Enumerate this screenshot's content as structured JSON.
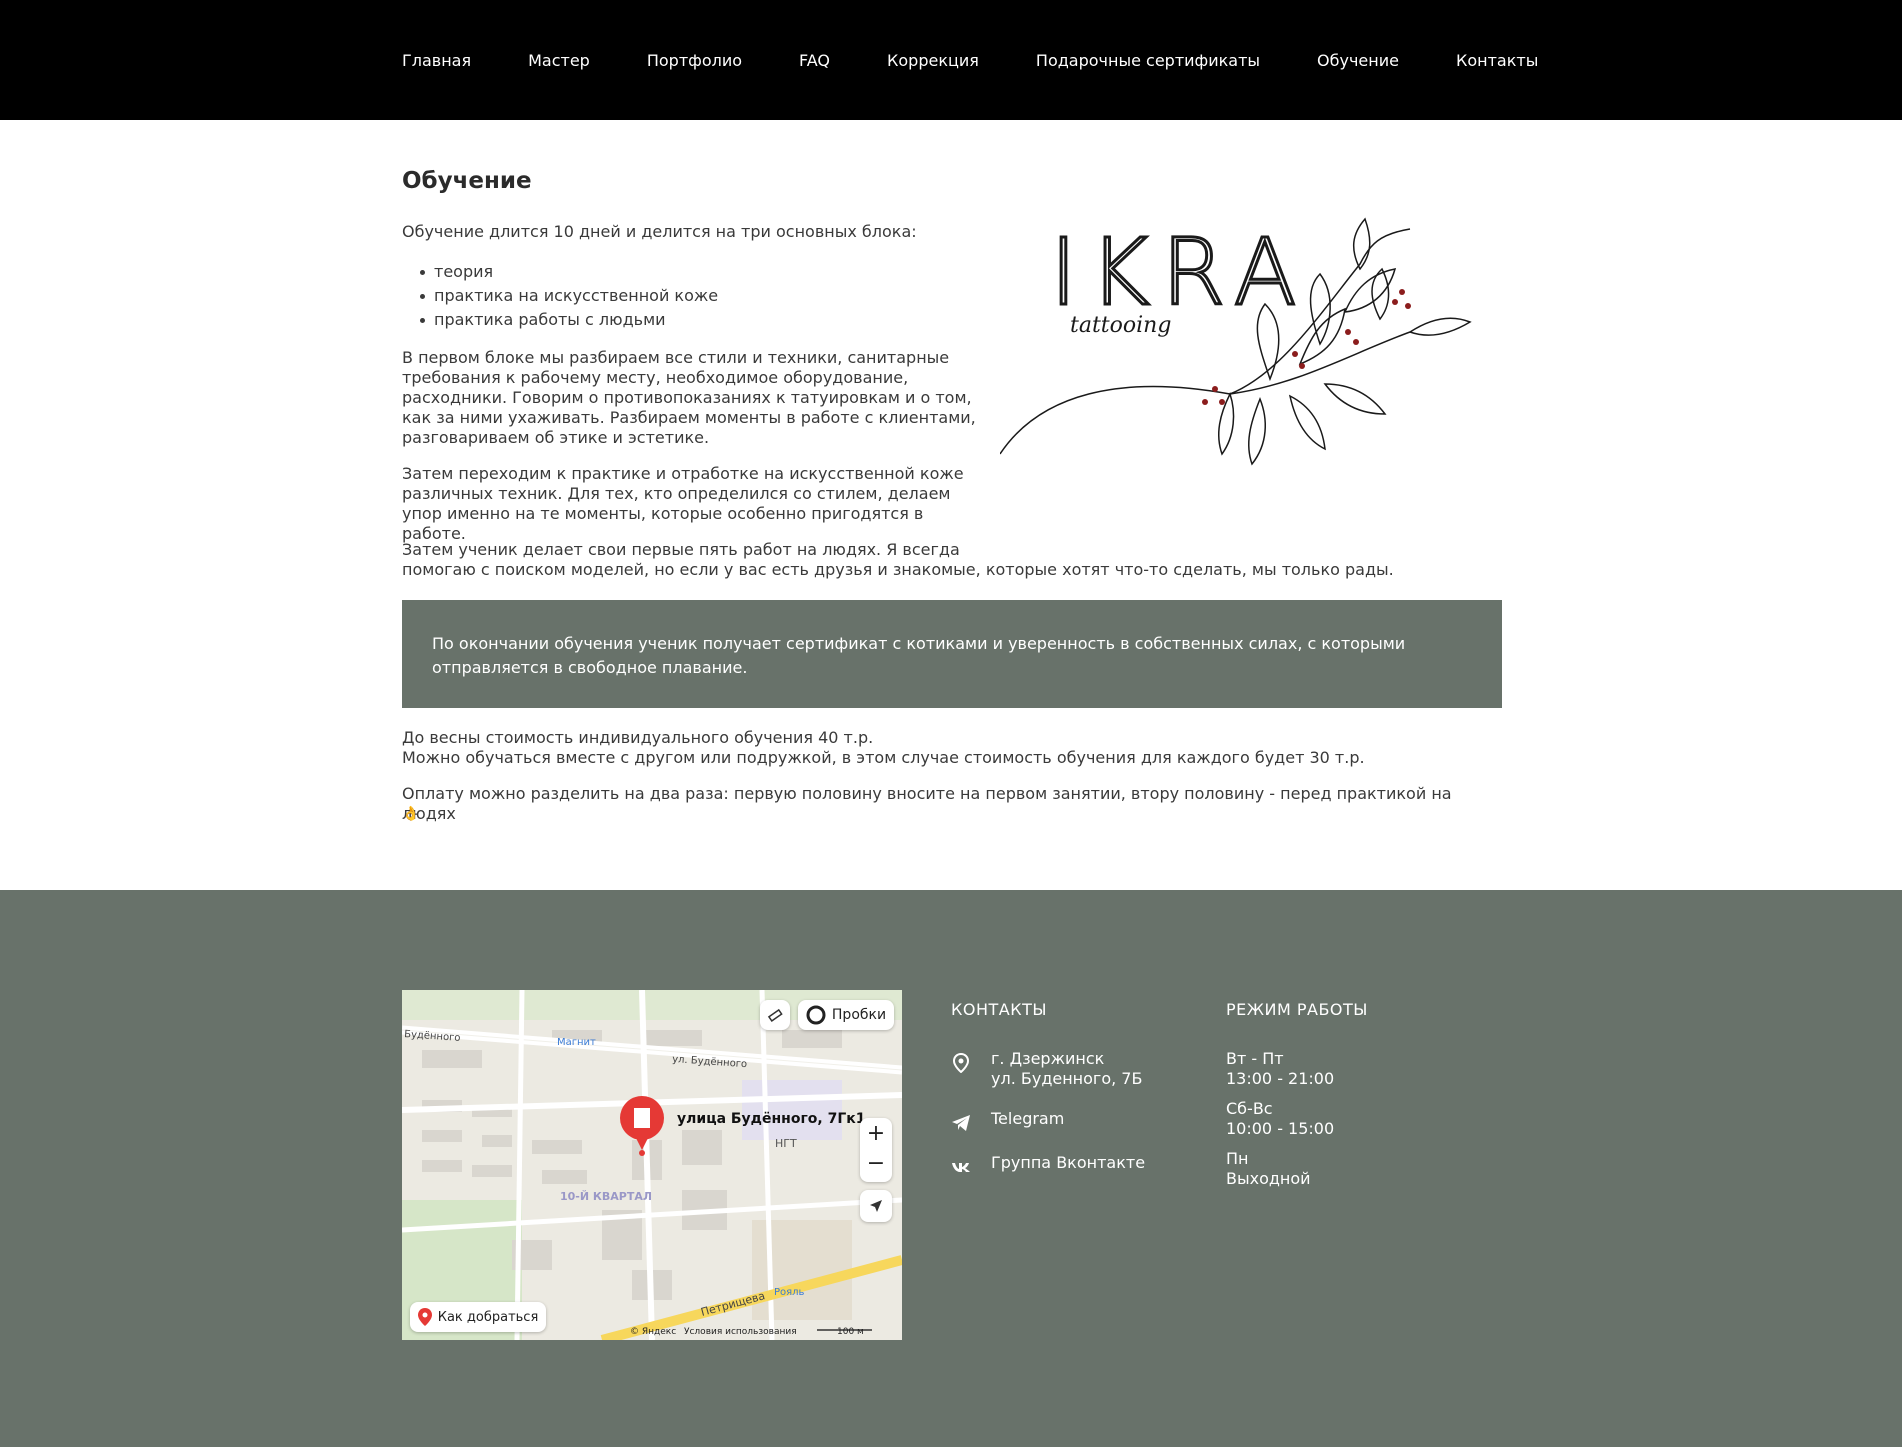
{
  "nav": {
    "items": [
      "Главная",
      "Мастер",
      "Портфолио",
      "FAQ",
      "Коррекция",
      "Подарочные сертификаты",
      "Обучение",
      "Контакты"
    ]
  },
  "page": {
    "title": "Обучение",
    "intro": "Обучение длится 10 дней и делится на три основных блока:",
    "blocks": [
      "теория",
      "практика на искусственной коже",
      "практика работы с людьми"
    ],
    "paragraph1": "В первом блоке мы разбираем все стили и техники, санитарные требования к рабочему месту, необходимое оборудование, расходники. Говорим о противопоказаниях к татуировкам и о том, как за ними ухаживать. Разбираем моменты в работе с клиентами, разговариваем об этике и эстетике.",
    "paragraph2": "Затем переходим к практике и отработке на искусственной коже различных техник. Для тех, кто определился со стилем, делаем упор именно на те моменты, которые особенно пригодятся в работе.",
    "paragraph3_line1": "Затем ученик делает свои первые пять работ на людях. Я всегда",
    "paragraph3_line2": "помогаю с поиском моделей, но если у вас есть друзья и знакомые, которые хотят что-то сделать, мы только рады.",
    "callout": "По окончании обучения ученик получает сертификат с котиками и уверенность в собственных силах, с которыми отправляется в свободное плавание.",
    "price1": "До весны стоимость индивидуального обучения 40 т.р.",
    "price2": "Можно обучаться вместе с другом или подружкой, в этом случае стоимость обучения для каждого будет 30 т.р.",
    "payment": "Оплату можно разделить на два раза: первую половину вносите на первом занятии, втору половину - перед практикой на людях",
    "payment_emoji": "👌",
    "logo_text": "IKRA",
    "logo_sub": "tattooing"
  },
  "map": {
    "traffic_label": "Пробки",
    "route_label": "Как добраться",
    "place_label": "улица Будённого, 7Гк1",
    "district_label": "10-Й КВАРТАЛ",
    "street1": "Будённого",
    "street2": "ул. Будённого",
    "poi1": "Магнит",
    "poi2": "Рояль",
    "poi3": "НГТ",
    "street3": "Петрищева",
    "copyright": "© Яндекс",
    "terms": "Условия использования",
    "scale": "100 м",
    "zoom_in": "+",
    "zoom_out": "−"
  },
  "footer": {
    "contacts_heading": "КОНТАКТЫ",
    "address_line1": "г. Дзержинск",
    "address_line2": "ул. Буденного, 7Б",
    "telegram": "Telegram",
    "vk": "Группа Вконтакте",
    "hours_heading": "РЕЖИМ РАБОТЫ",
    "hours": [
      {
        "days": "Вт - Пт",
        "time": "13:00 - 21:00"
      },
      {
        "days": "Сб-Вс",
        "time": "10:00 - 15:00"
      },
      {
        "days": "Пн",
        "time": "Выходной"
      }
    ]
  },
  "colors": {
    "nav_bg": "#000000",
    "accent_green": "#68726a",
    "text": "#3a3a3a",
    "pin_red": "#e53935"
  }
}
